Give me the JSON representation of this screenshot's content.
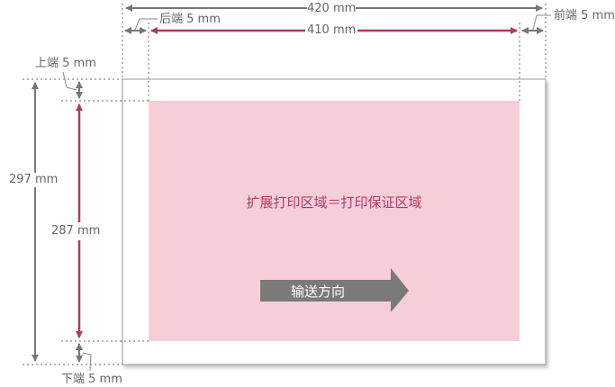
{
  "colors": {
    "accent": "#b03a66",
    "print_area": "#f6ced7",
    "dim_gray": "#777777",
    "arrow_gray": "#7a7a7a"
  },
  "dimensions": {
    "width_total": "420 mm",
    "width_print": "410 mm",
    "margin_back": "后端 5 mm",
    "margin_front": "前端 5 mm",
    "height_total": "297 mm",
    "height_print": "287 mm",
    "margin_top": "上端 5 mm",
    "margin_bottom": "下端 5 mm"
  },
  "print_area_label": "扩展打印区域＝打印保证区域",
  "feed_direction_label": "输送方向"
}
